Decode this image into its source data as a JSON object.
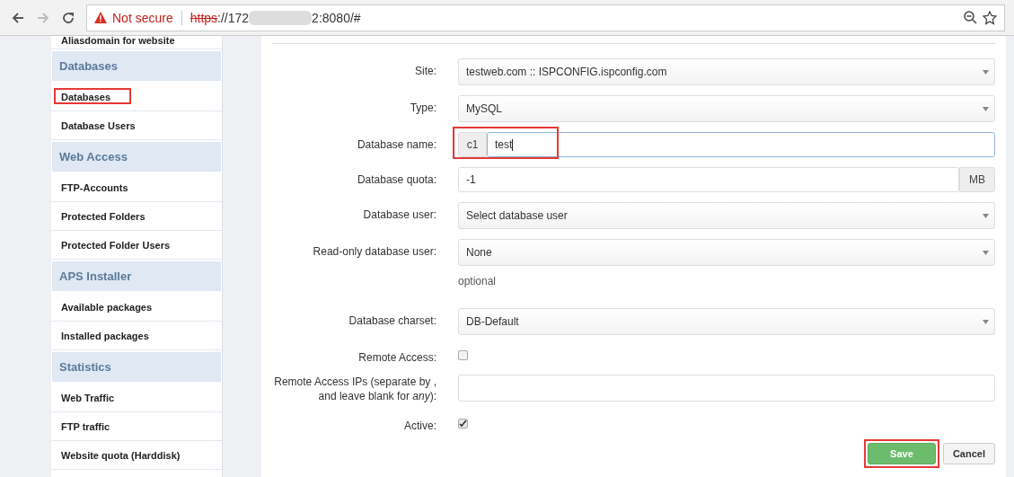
{
  "browser": {
    "security": "Not secure",
    "url_scheme": "https",
    "url_host_start": "://172",
    "url_end": "2:8080/#"
  },
  "sidebar": {
    "items": [
      {
        "kind": "item",
        "label": "Aliasdomain for website"
      },
      {
        "kind": "header",
        "label": "Databases"
      },
      {
        "kind": "item",
        "label": "Databases",
        "annotated": true
      },
      {
        "kind": "item",
        "label": "Database Users"
      },
      {
        "kind": "header",
        "label": "Web Access"
      },
      {
        "kind": "item",
        "label": "FTP-Accounts"
      },
      {
        "kind": "item",
        "label": "Protected Folders"
      },
      {
        "kind": "item",
        "label": "Protected Folder Users"
      },
      {
        "kind": "header",
        "label": "APS Installer"
      },
      {
        "kind": "item",
        "label": "Available packages"
      },
      {
        "kind": "item",
        "label": "Installed packages"
      },
      {
        "kind": "header",
        "label": "Statistics"
      },
      {
        "kind": "item",
        "label": "Web Traffic"
      },
      {
        "kind": "item",
        "label": "FTP traffic"
      },
      {
        "kind": "item",
        "label": "Website quota (Harddisk)"
      }
    ]
  },
  "form": {
    "fields": [
      {
        "kind": "select",
        "label": "Site:",
        "value": "testweb.com :: ISPCONFIG.ispconfig.com"
      },
      {
        "kind": "select",
        "label": "Type:",
        "value": "MySQL"
      },
      {
        "kind": "prefixed",
        "label": "Database name:",
        "prefix": "c1",
        "value": "test",
        "annotated": true
      },
      {
        "kind": "suffixed",
        "label": "Database quota:",
        "value": "-1",
        "suffix": "MB"
      },
      {
        "kind": "select",
        "label": "Database user:",
        "value": "Select database user"
      },
      {
        "kind": "select",
        "label": "Read-only database user:",
        "value": "None",
        "help": "optional"
      },
      {
        "kind": "select",
        "label": "Database charset:",
        "value": "DB-Default"
      },
      {
        "kind": "checkbox",
        "label": "Remote Access:",
        "checked": false
      },
      {
        "kind": "text",
        "label": "Remote Access IPs (separate by , and leave blank for *any*):"
      },
      {
        "kind": "checkbox",
        "label": "Active:",
        "checked": true
      }
    ],
    "buttons": [
      {
        "kind": "primary",
        "label": "Save",
        "annotated": true
      },
      {
        "kind": "default",
        "label": "Cancel"
      }
    ]
  }
}
